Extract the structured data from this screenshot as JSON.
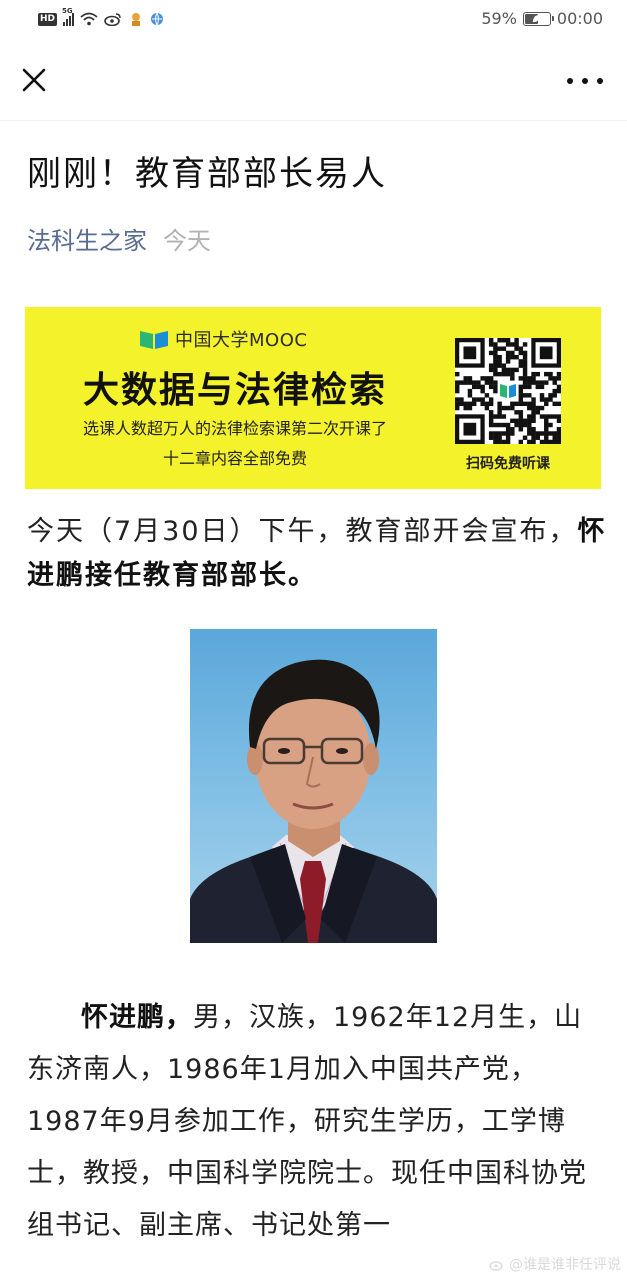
{
  "status_bar": {
    "hd": "HD",
    "network": "5G",
    "battery_percent": "59%",
    "battery_level": 0.59,
    "time": "00:00"
  },
  "nav": {
    "close_icon": "close-icon",
    "more_icon": "more-icon"
  },
  "article": {
    "title": "刚刚！教育部部长易人",
    "account": "法科生之家",
    "date": "今天"
  },
  "banner": {
    "brand": "中国大学MOOC",
    "title": "大数据与法律检索",
    "subtitle_1": "选课人数超万人的法律检索课第二次开课了",
    "subtitle_2": "十二章内容全部免费",
    "qr_label": "扫码免费听课",
    "background": "#f4f22a"
  },
  "paragraph_1": {
    "text": "今天（7月30日）下午，教育部开会宣布，",
    "bold": "怀进鹏接任教育部部长。"
  },
  "paragraph_2": {
    "bold": "怀进鹏，",
    "text": "男，汉族，1962年12月生，山东济南人，1986年1月加入中国共产党，1987年9月参加工作，研究生学历，工学博士，教授，中国科学院院士。现任中国科协党组书记、副主席、书记处第一"
  },
  "watermark": "@谁是谁非任评说",
  "colors": {
    "link": "#576b95",
    "date": "#b2b2b2"
  }
}
